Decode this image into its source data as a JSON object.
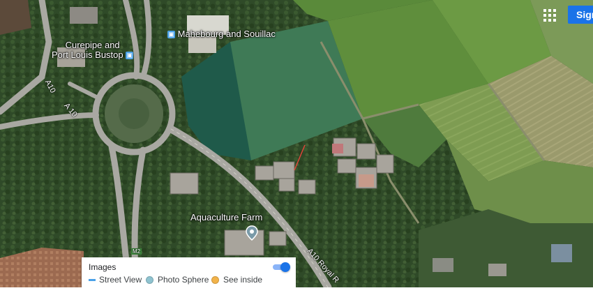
{
  "map": {
    "mode": "satellite",
    "places": [
      {
        "id": "mahebourg",
        "name": "Mahebourg and Souillac",
        "icon": "bus-stop-icon"
      },
      {
        "id": "curepipe",
        "line1": "Curepipe and",
        "line2": "Port Louis Bustop",
        "icon": "bus-stop-icon"
      },
      {
        "id": "aquaculture",
        "name": "Aquaculture Farm",
        "icon": "place-pin-icon"
      }
    ],
    "roads": {
      "a10_north": "A10",
      "a10_west": "A 10",
      "a10_east": "A10 Royal R",
      "m2": "M2"
    }
  },
  "header": {
    "apps_icon": "apps-grid-icon",
    "signin_label": "Sign in"
  },
  "layer_panel": {
    "title": "Images",
    "toggle_on": true,
    "legend": [
      {
        "label": "Street View",
        "color": "#4aa1e8",
        "shape": "line"
      },
      {
        "label": "Photo Sphere",
        "color": "#8fc3d0",
        "shape": "dot"
      },
      {
        "label": "See inside",
        "color": "#f2b34a",
        "shape": "dot"
      }
    ]
  },
  "colors": {
    "accent": "#1a73e8",
    "street_view_blue": "#4aa1e8"
  }
}
